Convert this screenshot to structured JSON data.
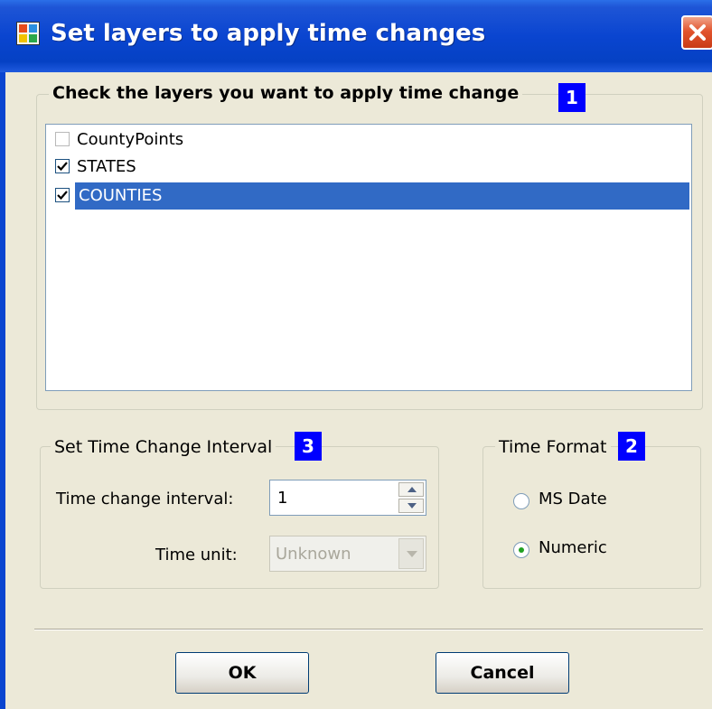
{
  "window": {
    "title": "Set layers to apply time changes"
  },
  "layers_group": {
    "legend": "Check the layers you want to apply time change",
    "badge": "1",
    "items": [
      {
        "label": "CountyPoints",
        "checked": false,
        "selected": false
      },
      {
        "label": "STATES",
        "checked": true,
        "selected": false
      },
      {
        "label": "COUNTIES",
        "checked": true,
        "selected": true
      }
    ]
  },
  "interval_group": {
    "legend": "Set Time Change Interval",
    "badge": "3",
    "interval_label": "Time change interval:",
    "interval_value": "1",
    "unit_label": "Time unit:",
    "unit_value": "Unknown"
  },
  "format_group": {
    "legend": "Time Format",
    "badge": "2",
    "options": [
      {
        "label": "MS Date",
        "selected": false
      },
      {
        "label": "Numeric",
        "selected": true
      }
    ]
  },
  "buttons": {
    "ok": "OK",
    "cancel": "Cancel"
  },
  "colors": {
    "title_bar": "#0a45d0",
    "selection": "#316ac5",
    "badge": "#0000ff"
  }
}
